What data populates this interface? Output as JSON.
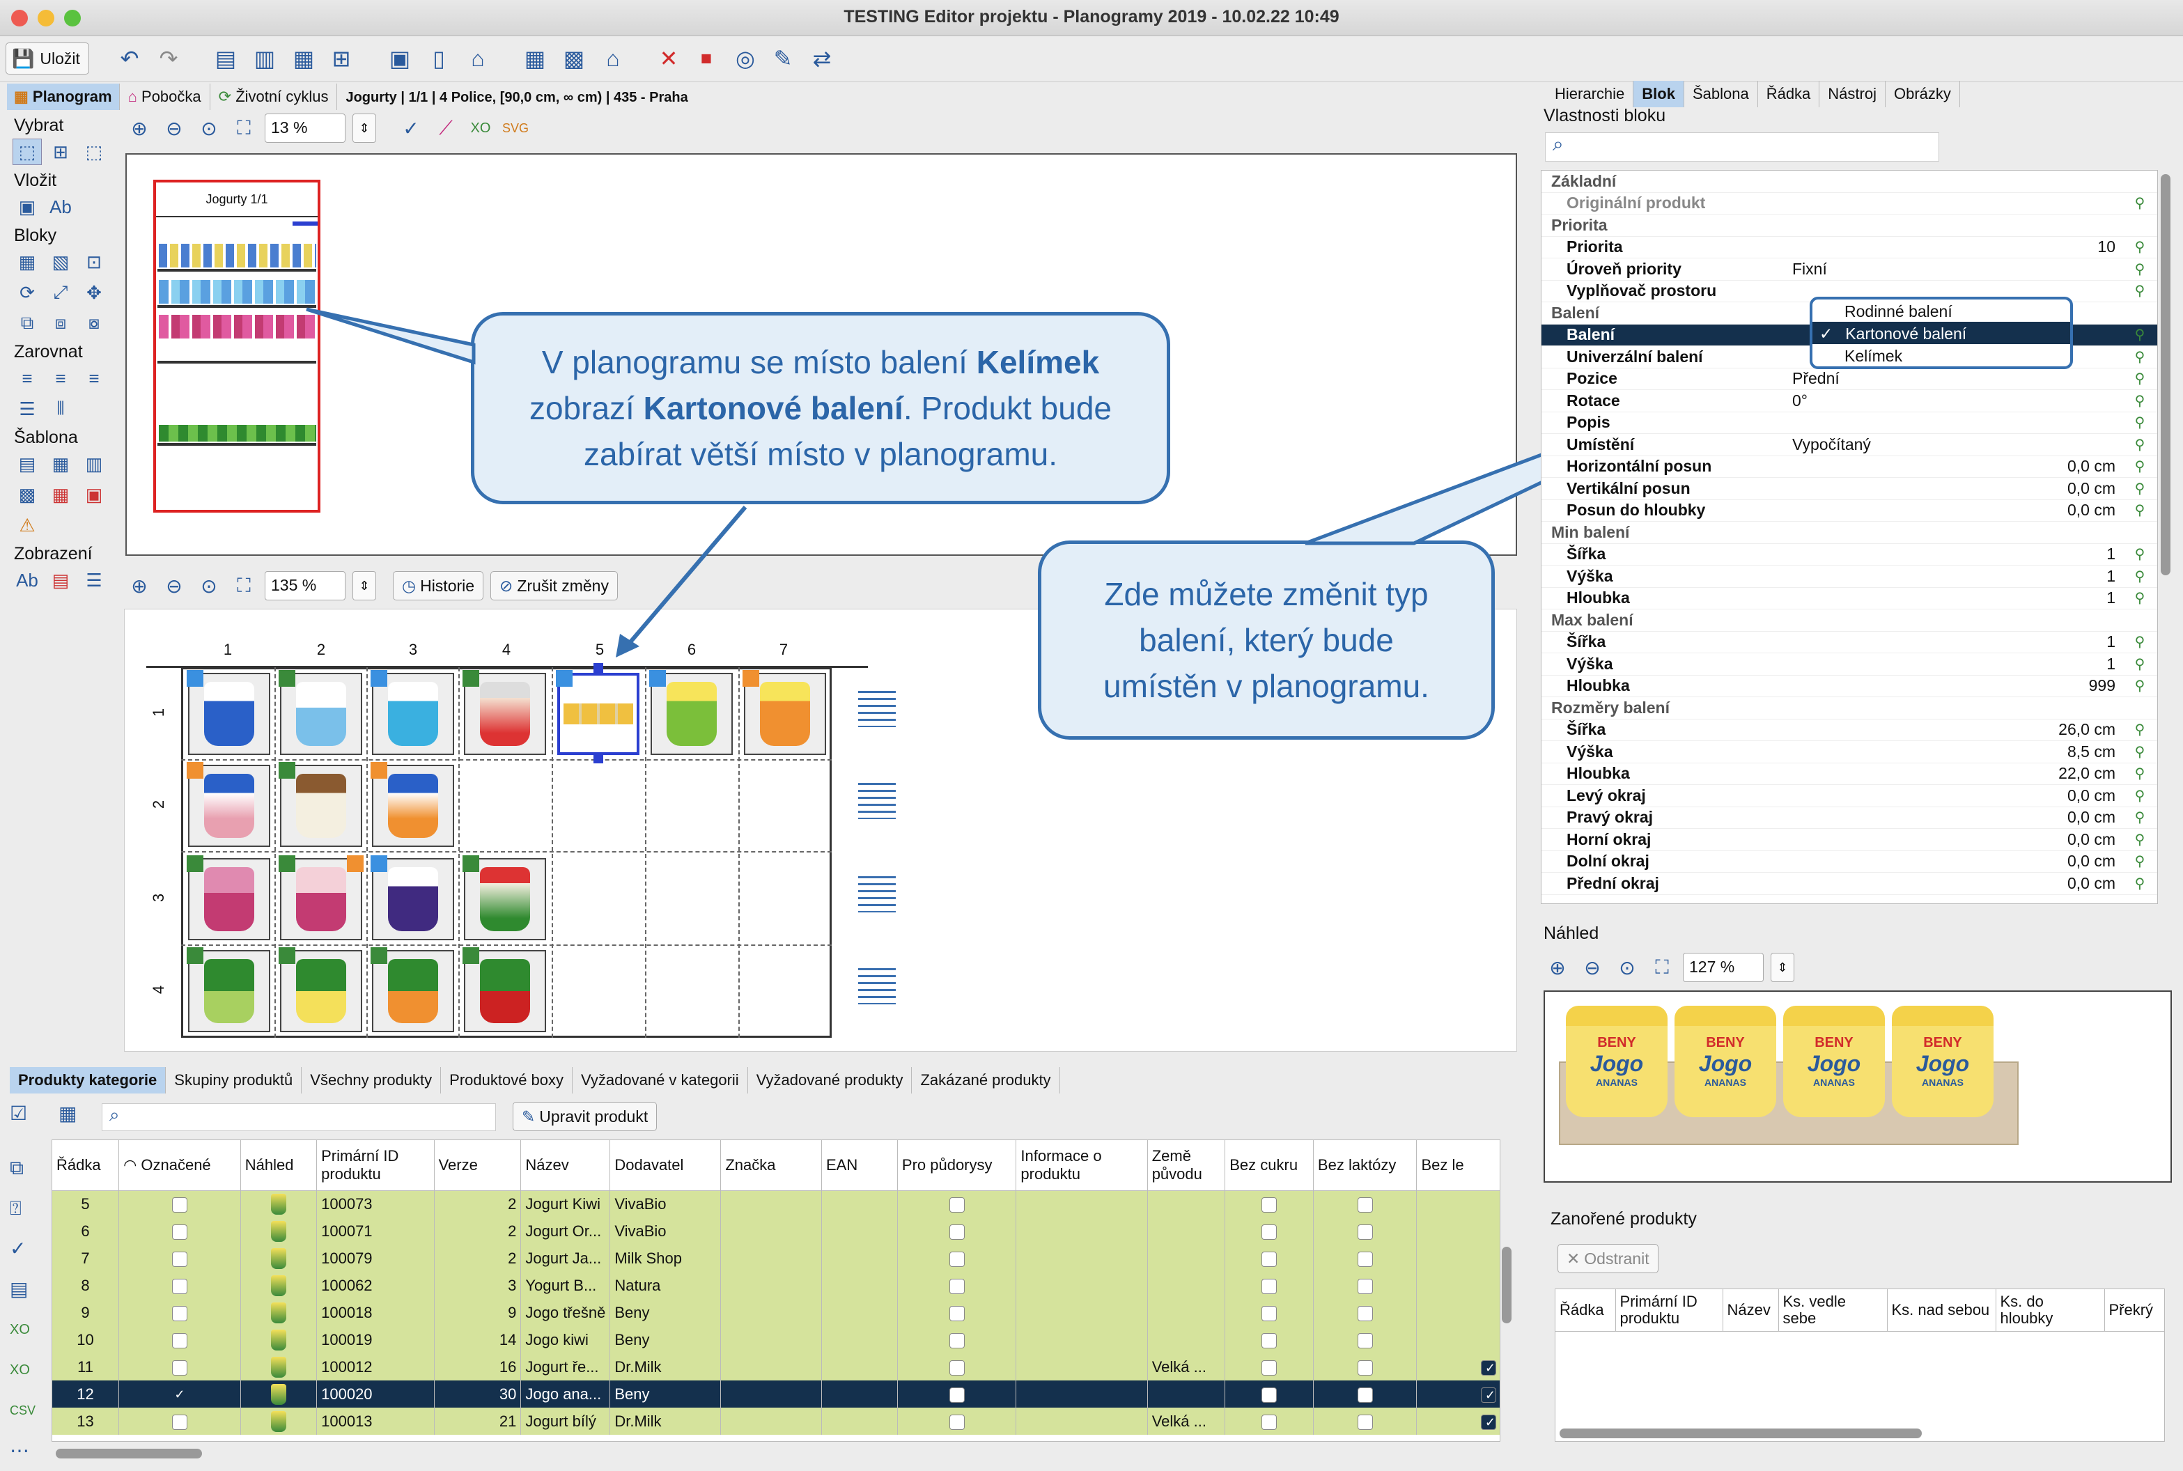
{
  "window": {
    "title": "TESTING Editor projektu - Planogramy 2019 - 10.02.22 10:49"
  },
  "toolbar": {
    "save_label": "Uložit"
  },
  "nav_tabs": [
    {
      "label": "Planogram"
    },
    {
      "label": "Pobočka"
    },
    {
      "label": "Životní cyklus"
    }
  ],
  "context_info": "Jogurty | 1/1 | 4 Police, [90,0 cm, ∞ cm) | 435 - Praha",
  "left_tools": {
    "select": "Vybrat",
    "insert": "Vložit",
    "blocks": "Bloky",
    "align": "Zarovnat",
    "template": "Šablona",
    "display": "Zobrazení"
  },
  "overview": {
    "zoom": "13 %",
    "shelf_title": "Jogurty 1/1"
  },
  "detail": {
    "zoom": "135 %",
    "history_label": "Historie",
    "undo_changes_label": "Zrušit změny",
    "columns": [
      "1",
      "2",
      "3",
      "4",
      "5",
      "6",
      "7"
    ],
    "rows": [
      "1",
      "2",
      "3",
      "4"
    ]
  },
  "callouts": {
    "first": {
      "line1_a": "V planogramu se místo balení ",
      "line1_b": "Kelímek",
      "line2_a": "zobrazí ",
      "line2_b": "Kartonové balení",
      "line2_c": ". Produkt bude",
      "line3": "zabírat větší místo v planogramu."
    },
    "second": {
      "line1": "Zde můžete změnit typ",
      "line2": "balení, který bude",
      "line3": "umístěn v planogramu."
    }
  },
  "bottom_tabs": [
    "Produkty kategorie",
    "Skupiny produktů",
    "Všechny produkty",
    "Produktové boxy",
    "Vyžadované v kategorii",
    "Vyžadované produkty",
    "Zakázané produkty"
  ],
  "product_toolbar": {
    "edit_label": "Upravit produkt"
  },
  "product_table": {
    "headers": [
      "Řádka",
      "Označené",
      "Náhled",
      "Primární ID produktu",
      "Verze",
      "Název",
      "Dodavatel",
      "Značka",
      "EAN",
      "Pro půdorysy",
      "Informace o produktu",
      "Země původu",
      "Bez cukru",
      "Bez laktózy",
      "Bez le"
    ],
    "rows": [
      {
        "row": "5",
        "id": "100073",
        "ver": "2",
        "name": "Jogurt Kiwi",
        "supplier": "VivaBio",
        "country": ""
      },
      {
        "row": "6",
        "id": "100071",
        "ver": "2",
        "name": "Jogurt Or...",
        "supplier": "VivaBio",
        "country": ""
      },
      {
        "row": "7",
        "id": "100079",
        "ver": "2",
        "name": "Jogurt Ja...",
        "supplier": "Milk Shop",
        "country": ""
      },
      {
        "row": "8",
        "id": "100062",
        "ver": "3",
        "name": "Yogurt B...",
        "supplier": "Natura",
        "country": ""
      },
      {
        "row": "9",
        "id": "100018",
        "ver": "9",
        "name": "Jogo třešně",
        "supplier": "Beny",
        "country": ""
      },
      {
        "row": "10",
        "id": "100019",
        "ver": "14",
        "name": "Jogo kiwi",
        "supplier": "Beny",
        "country": ""
      },
      {
        "row": "11",
        "id": "100012",
        "ver": "16",
        "name": "Jogurt ře...",
        "supplier": "Dr.Milk",
        "country": "Velká ..."
      },
      {
        "row": "12",
        "id": "100020",
        "ver": "30",
        "name": "Jogo ana...",
        "supplier": "Beny",
        "country": ""
      },
      {
        "row": "13",
        "id": "100013",
        "ver": "21",
        "name": "Jogurt bílý",
        "supplier": "Dr.Milk",
        "country": "Velká ..."
      }
    ]
  },
  "right_tabs": [
    "Hierarchie",
    "Blok",
    "Šablona",
    "Řádka",
    "Nástroj",
    "Obrázky"
  ],
  "props": {
    "title": "Vlastnosti bloku",
    "rows": [
      {
        "type": "cat",
        "name": "Základní",
        "value": ""
      },
      {
        "type": "dim",
        "name": "Originální produkt",
        "value": ""
      },
      {
        "type": "cat",
        "name": "Priorita",
        "value": ""
      },
      {
        "type": "p",
        "name": "Priorita",
        "value": "10"
      },
      {
        "type": "p",
        "name": "Úroveň priority",
        "value": "Fixní"
      },
      {
        "type": "p",
        "name": "Vyplňovač prostoru",
        "value": ""
      },
      {
        "type": "cat",
        "name": "Balení",
        "value": ""
      },
      {
        "type": "sel",
        "name": "Balení",
        "value": ""
      },
      {
        "type": "p",
        "name": "Univerzální balení",
        "value": ""
      },
      {
        "type": "p",
        "name": "Pozice",
        "value": "Přední"
      },
      {
        "type": "p",
        "name": "Rotace",
        "value": "0°"
      },
      {
        "type": "p",
        "name": "Popis",
        "value": ""
      },
      {
        "type": "p",
        "name": "Umístění",
        "value": "Vypočítaný"
      },
      {
        "type": "p",
        "name": "Horizontální posun",
        "value": "0,0 cm"
      },
      {
        "type": "p",
        "name": "Vertikální posun",
        "value": "0,0 cm"
      },
      {
        "type": "p",
        "name": "Posun do hloubky",
        "value": "0,0 cm"
      },
      {
        "type": "cat",
        "name": "Min balení",
        "value": ""
      },
      {
        "type": "p",
        "name": "Šířka",
        "value": "1"
      },
      {
        "type": "p",
        "name": "Výška",
        "value": "1"
      },
      {
        "type": "p",
        "name": "Hloubka",
        "value": "1"
      },
      {
        "type": "cat",
        "name": "Max balení",
        "value": ""
      },
      {
        "type": "p",
        "name": "Šířka",
        "value": "1"
      },
      {
        "type": "p",
        "name": "Výška",
        "value": "1"
      },
      {
        "type": "p",
        "name": "Hloubka",
        "value": "999"
      },
      {
        "type": "cat",
        "name": "Rozměry balení",
        "value": ""
      },
      {
        "type": "p",
        "name": "Šířka",
        "value": "26,0 cm"
      },
      {
        "type": "p",
        "name": "Výška",
        "value": "8,5 cm"
      },
      {
        "type": "p",
        "name": "Hloubka",
        "value": "22,0 cm"
      },
      {
        "type": "p",
        "name": "Levý okraj",
        "value": "0,0 cm"
      },
      {
        "type": "p",
        "name": "Pravý okraj",
        "value": "0,0 cm"
      },
      {
        "type": "p",
        "name": "Horní okraj",
        "value": "0,0 cm"
      },
      {
        "type": "p",
        "name": "Dolní okraj",
        "value": "0,0 cm"
      },
      {
        "type": "p",
        "name": "Přední okraj",
        "value": "0,0 cm"
      }
    ]
  },
  "dropdown": {
    "options": [
      "Rodinné balení",
      "Kartonové balení",
      "Kelímek"
    ],
    "selected": "Kartonové balení",
    "check": "✓"
  },
  "preview": {
    "title": "Náhled",
    "zoom": "127 %",
    "brand": "BENY",
    "product": "Jogo",
    "flavor": "ANANAS"
  },
  "nested": {
    "title": "Zanořené produkty",
    "remove_label": "Odstranit",
    "headers": [
      "Řádka",
      "Primární ID produktu",
      "Název",
      "Ks. vedle sebe",
      "Ks. nad sebou",
      "Ks. do hloubky",
      "Překrý"
    ]
  },
  "colors": {
    "accent": "#3670b0",
    "row_green": "#d5e39c",
    "selected_row": "#14304d",
    "tab_active": "#b9d3ee"
  }
}
